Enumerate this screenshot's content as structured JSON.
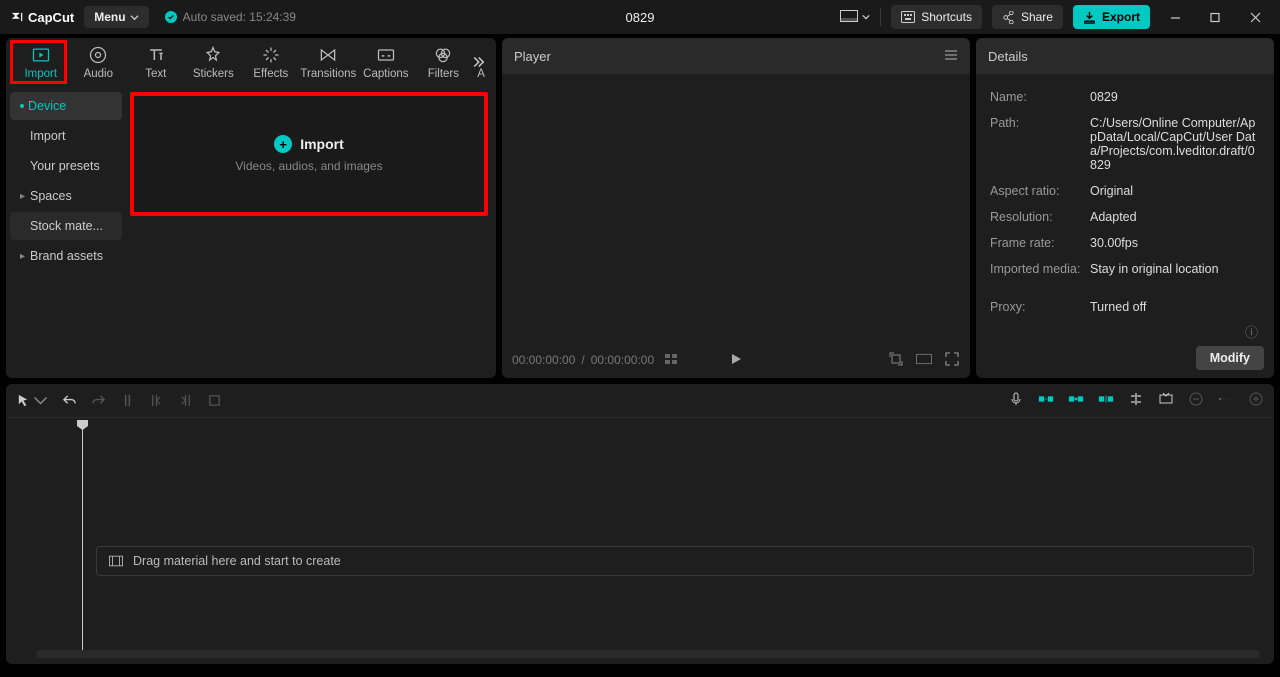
{
  "titlebar": {
    "app_name": "CapCut",
    "menu_label": "Menu",
    "autosave_text": "Auto saved: 15:24:39",
    "project_title": "0829",
    "shortcuts_label": "Shortcuts",
    "share_label": "Share",
    "export_label": "Export"
  },
  "top_tabs": {
    "items": [
      {
        "label": "Import"
      },
      {
        "label": "Audio"
      },
      {
        "label": "Text"
      },
      {
        "label": "Stickers"
      },
      {
        "label": "Effects"
      },
      {
        "label": "Transitions"
      },
      {
        "label": "Captions"
      },
      {
        "label": "Filters"
      },
      {
        "label": "A"
      }
    ]
  },
  "sidebar": {
    "items": [
      {
        "label": "Device",
        "active": true
      },
      {
        "label": "Import"
      },
      {
        "label": "Your presets"
      },
      {
        "label": "Spaces",
        "caret": true
      },
      {
        "label": "Stock mate...",
        "bg": true
      },
      {
        "label": "Brand assets",
        "caret": true
      }
    ]
  },
  "import_box": {
    "title": "Import",
    "subtitle": "Videos, audios, and images"
  },
  "player": {
    "title": "Player",
    "time_current": "00:00:00:00",
    "time_sep": " / ",
    "time_total": "00:00:00:00"
  },
  "details": {
    "title": "Details",
    "rows": {
      "name": {
        "label": "Name:",
        "value": "0829"
      },
      "path": {
        "label": "Path:",
        "value": "C:/Users/Online Computer/AppData/Local/CapCut/User Data/Projects/com.lveditor.draft/0829"
      },
      "aspect": {
        "label": "Aspect ratio:",
        "value": "Original"
      },
      "resolution": {
        "label": "Resolution:",
        "value": "Adapted"
      },
      "framerate": {
        "label": "Frame rate:",
        "value": "30.00fps"
      },
      "imported": {
        "label": "Imported media:",
        "value": "Stay in original location"
      },
      "proxy": {
        "label": "Proxy:",
        "value": "Turned off"
      }
    },
    "modify_label": "Modify"
  },
  "timeline": {
    "placeholder": "Drag material here and start to create"
  }
}
